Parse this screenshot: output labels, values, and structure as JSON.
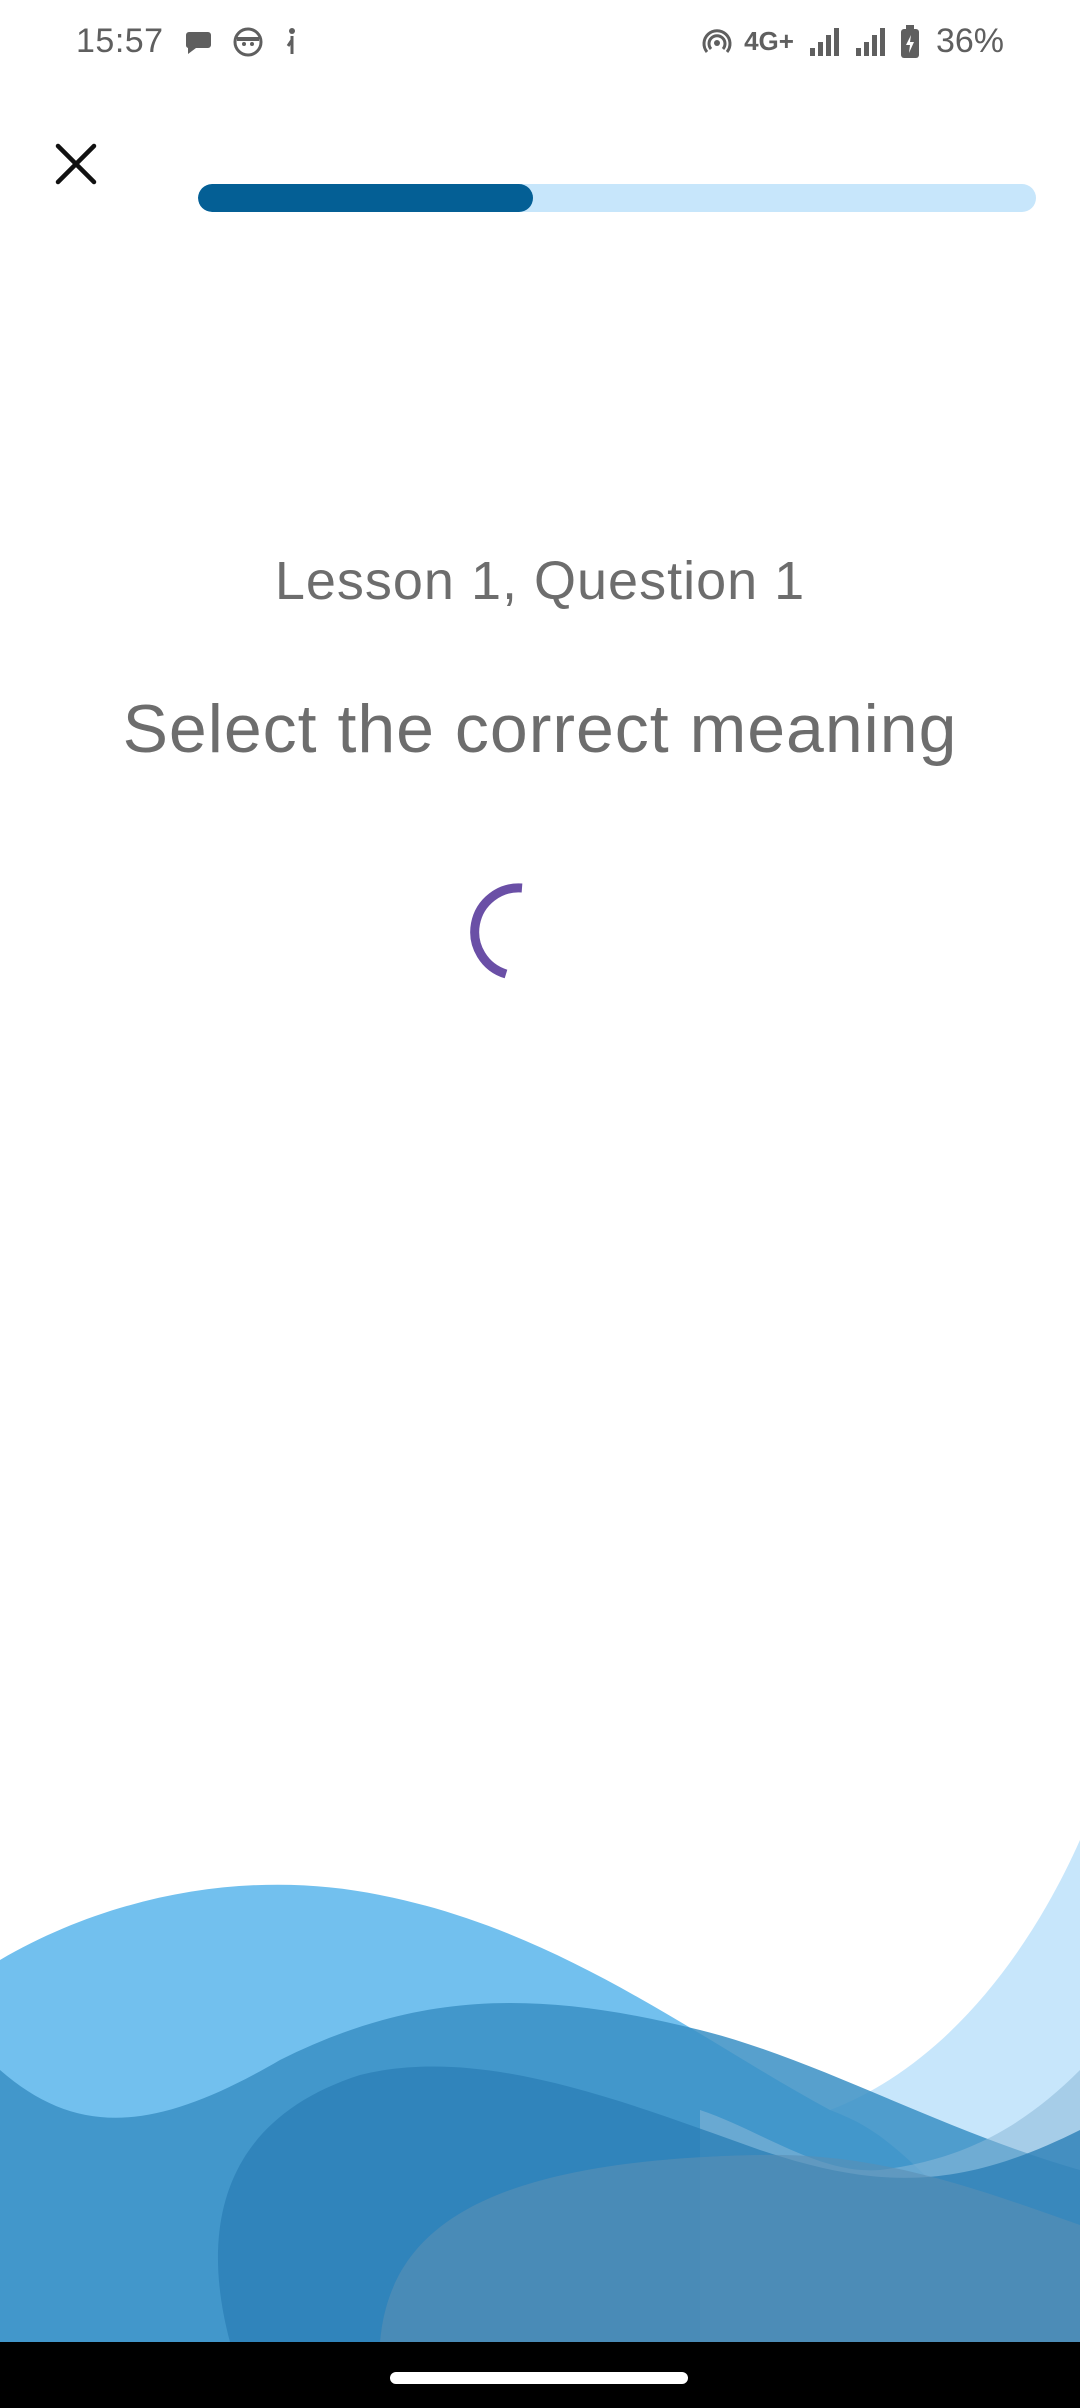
{
  "status_bar": {
    "time": "15:57",
    "network_type": "4G+",
    "battery_percent": "36%",
    "icons": [
      "chat-bubble-icon",
      "face-icon",
      "figure-icon",
      "hotspot-icon",
      "signal-icon",
      "signal-icon",
      "battery-icon"
    ]
  },
  "top_bar": {
    "close_icon": "close-icon",
    "progress_fraction": 0.4
  },
  "content": {
    "lesson_label": "Lesson 1, Question 1",
    "instruction": "Select the correct meaning",
    "loading_indicator": "spinner-icon"
  },
  "colors": {
    "progress_fill": "#045f95",
    "progress_track": "#c7e6fb",
    "spinner": "#6a4fa6",
    "text": "#6d6d6d",
    "wave_light": "#c7e6fb",
    "wave_mid": "#72c0ee",
    "wave_dark": "#2c7fb6"
  }
}
